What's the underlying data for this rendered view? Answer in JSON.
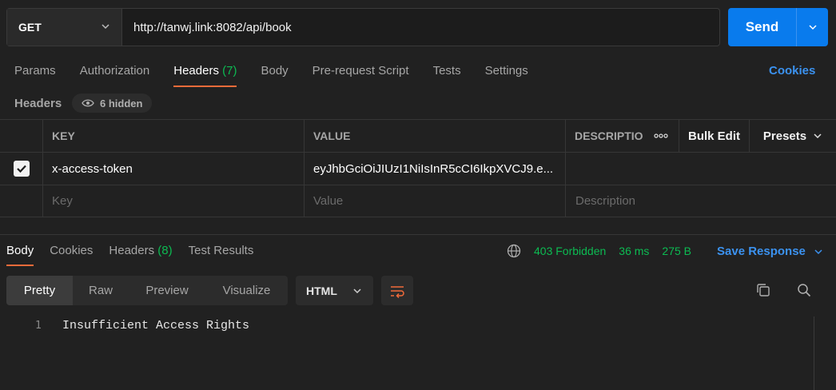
{
  "request": {
    "method": "GET",
    "url": "http://tanwj.link:8082/api/book",
    "send_label": "Send"
  },
  "request_tabs": [
    {
      "label": "Params"
    },
    {
      "label": "Authorization"
    },
    {
      "label": "Headers",
      "count": "(7)"
    },
    {
      "label": "Body"
    },
    {
      "label": "Pre-request Script"
    },
    {
      "label": "Tests"
    },
    {
      "label": "Settings"
    }
  ],
  "cookies_label": "Cookies",
  "headers_section": {
    "label": "Headers",
    "hidden_label": "6 hidden"
  },
  "table": {
    "columns": {
      "key": "KEY",
      "value": "VALUE",
      "description": "DESCRIPTIO"
    },
    "bulk_edit": "Bulk Edit",
    "presets": "Presets",
    "rows": [
      {
        "key": "x-access-token",
        "value": "eyJhbGciOiJIUzI1NiIsInR5cCI6IkpXVCJ9.e..."
      }
    ],
    "placeholders": {
      "key": "Key",
      "value": "Value",
      "description": "Description"
    }
  },
  "response_tabs": [
    {
      "label": "Body"
    },
    {
      "label": "Cookies"
    },
    {
      "label": "Headers",
      "count": "(8)"
    },
    {
      "label": "Test Results"
    }
  ],
  "response_status": {
    "status": "403 Forbidden",
    "time": "36 ms",
    "size": "275 B",
    "save_label": "Save Response"
  },
  "view_modes": [
    "Pretty",
    "Raw",
    "Preview",
    "Visualize"
  ],
  "format": "HTML",
  "response_body": {
    "line_number": "1",
    "text": "Insufficient Access Rights"
  },
  "colors": {
    "accent_blue": "#097bed",
    "tab_underline": "#f26b3a",
    "status_green": "#0cbb52",
    "link_blue": "#3b92f0"
  }
}
